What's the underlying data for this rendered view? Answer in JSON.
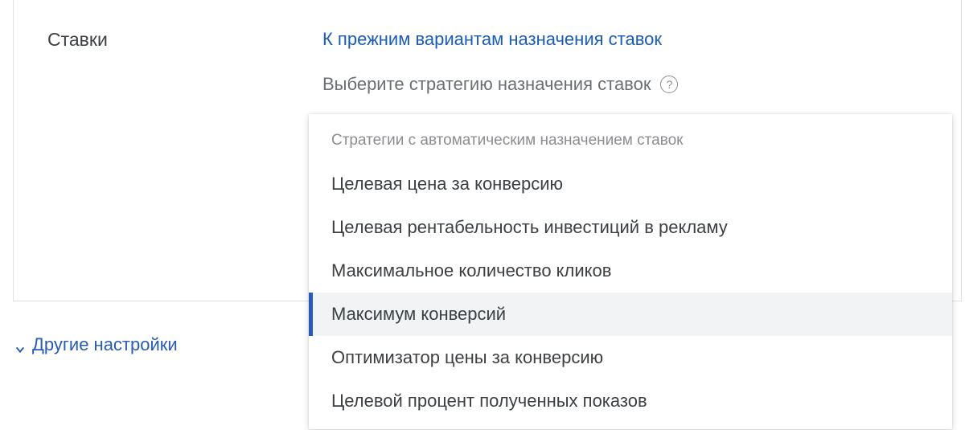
{
  "section": {
    "label": "Ставки"
  },
  "link": {
    "previous_options": "К прежним вариантам назначения ставок"
  },
  "prompt": {
    "text": "Выберите стратегию назначения ставок",
    "help_symbol": "?"
  },
  "dropdown": {
    "group_label": "Стратегии с автоматическим назначением ставок",
    "items": [
      {
        "label": "Целевая цена за конверсию",
        "selected": false
      },
      {
        "label": "Целевая рентабельность инвестиций в рекламу",
        "selected": false
      },
      {
        "label": "Максимальное количество кликов",
        "selected": false
      },
      {
        "label": "Максимум конверсий",
        "selected": true
      },
      {
        "label": "Оптимизатор цены за конверсию",
        "selected": false
      },
      {
        "label": "Целевой процент полученных показов",
        "selected": false
      }
    ]
  },
  "more_settings": {
    "label": "Другие настройки"
  }
}
